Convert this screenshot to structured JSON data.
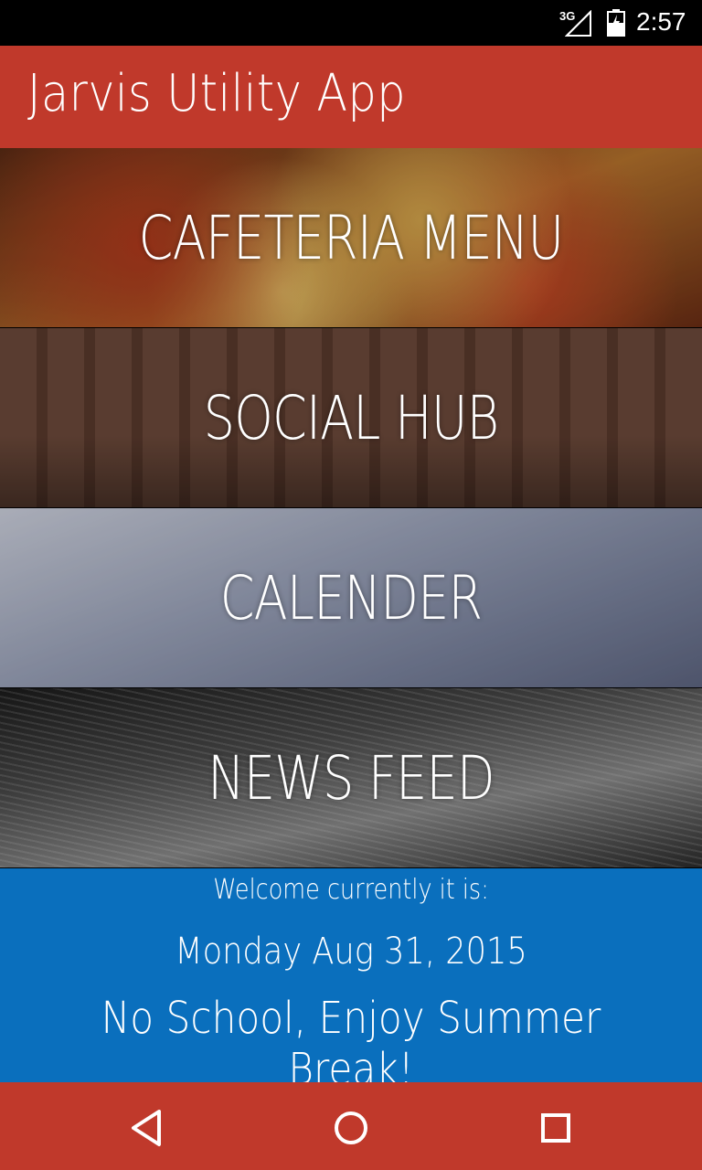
{
  "status_bar": {
    "network": "3G",
    "time": "2:57",
    "signal_icon": "signal-icon",
    "battery_icon": "battery-charging-icon"
  },
  "app_bar": {
    "title": "Jarvis Utility App",
    "color": "#c0392b"
  },
  "tiles": [
    {
      "label": "CAFETERIA MENU",
      "icon": "pizza-image"
    },
    {
      "label": "SOCIAL HUB",
      "icon": "students-image"
    },
    {
      "label": "CALENDER",
      "icon": "calendar-image"
    },
    {
      "label": "NEWS FEED",
      "icon": "newspaper-image"
    }
  ],
  "welcome": {
    "intro": "Welcome currently it is:",
    "date": "Monday Aug 31, 2015",
    "message": "No School, Enjoy Summer Break!",
    "color": "#0a6fbd"
  },
  "nav_bar": {
    "back_icon": "back-icon",
    "home_icon": "home-icon",
    "recent_icon": "recent-apps-icon",
    "color": "#c0392b"
  }
}
